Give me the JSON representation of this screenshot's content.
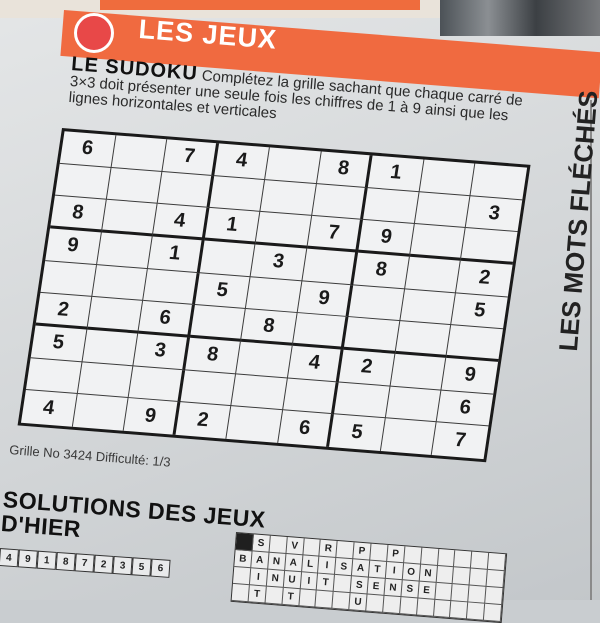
{
  "header": {
    "title": "LES JEUX"
  },
  "instructions": {
    "title": "LE SUDOKU",
    "text": "Complétez la grille sachant que chaque carré de 3×3 doit présenter une seule fois les chiffres de 1 à 9 ainsi que les lignes horizontales et verticales"
  },
  "sudoku": {
    "rows": [
      [
        "6",
        "",
        "7",
        "4",
        "",
        "8",
        "1",
        "",
        ""
      ],
      [
        "",
        "",
        "",
        "",
        "",
        "",
        "",
        "",
        "3"
      ],
      [
        "8",
        "",
        "4",
        "1",
        "",
        "7",
        "9",
        "",
        ""
      ],
      [
        "9",
        "",
        "1",
        "",
        "3",
        "",
        "8",
        "",
        "2"
      ],
      [
        "",
        "",
        "",
        "5",
        "",
        "9",
        "",
        "",
        "5"
      ],
      [
        "2",
        "",
        "6",
        "",
        "8",
        "",
        "",
        "",
        ""
      ],
      [
        "5",
        "",
        "3",
        "8",
        "",
        "4",
        "2",
        "",
        "9"
      ],
      [
        "",
        "",
        "",
        "",
        "",
        "",
        "",
        "",
        "6"
      ],
      [
        "4",
        "",
        "9",
        "2",
        "",
        "6",
        "5",
        "",
        "7"
      ]
    ]
  },
  "caption": {
    "text": "Grille No 3424  Difficulté: 1/3"
  },
  "side": {
    "title": "LES MOTS FLÉCHÉS"
  },
  "solutions": {
    "line1": "SOLUTIONS  DES JEUX",
    "line2": "D'HIER"
  },
  "solution_strip": [
    "4",
    "9",
    "1",
    "8",
    "7",
    "2",
    "3",
    "5",
    "6"
  ],
  "crossword": {
    "rows": [
      [
        "#",
        "S",
        "",
        "V",
        "",
        "R",
        "",
        "P",
        "",
        "P",
        "",
        "",
        "",
        "",
        "",
        ""
      ],
      [
        "B",
        "A",
        "N",
        "A",
        "L",
        "I",
        "S",
        "A",
        "T",
        "I",
        "O",
        "N",
        "",
        "",
        "",
        ""
      ],
      [
        "",
        "I",
        "N",
        "U",
        "I",
        "T",
        "",
        "S",
        "E",
        "N",
        "S",
        "E",
        "",
        "",
        "",
        ""
      ],
      [
        "",
        "T",
        "",
        "T",
        "",
        "",
        "",
        "U",
        "",
        "",
        "",
        "",
        "",
        "",
        "",
        ""
      ]
    ]
  }
}
